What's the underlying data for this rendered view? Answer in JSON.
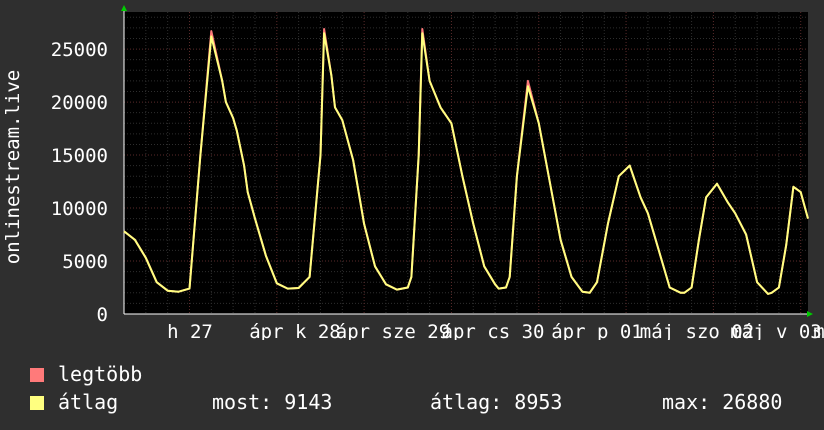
{
  "chart_data": {
    "type": "line",
    "ylabel": "onlinestream.live",
    "ylim": [
      0,
      28500
    ],
    "yticks": [
      0,
      5000,
      10000,
      15000,
      20000,
      25000
    ],
    "x_tick_labels": [
      "h 27",
      "ápr k 28",
      "ápr sze 29",
      "ápr cs 30",
      "ápr p 01",
      "máj szo 02",
      "máj v 03",
      "m"
    ],
    "grid": true,
    "series": [
      {
        "name": "legtöbb",
        "color": "#ff7a7a"
      },
      {
        "name": "átlag",
        "color": "#ffff80"
      }
    ],
    "x_hours": [
      0,
      3,
      6,
      9,
      12,
      15,
      18,
      21,
      24,
      27,
      28,
      30,
      31,
      33,
      34,
      36,
      39,
      42,
      45,
      48,
      51,
      54,
      55,
      57,
      58,
      60,
      63,
      66,
      69,
      72,
      75,
      78,
      79,
      81,
      82,
      84,
      87,
      90,
      93,
      96,
      99,
      102,
      103,
      105,
      106,
      108,
      111,
      114,
      117,
      120,
      123,
      126,
      128,
      130,
      133,
      136,
      139,
      142,
      144,
      147,
      150,
      153,
      154,
      156,
      158,
      160,
      163,
      166,
      168,
      171,
      174,
      177,
      178,
      180,
      182,
      184,
      186,
      188
    ],
    "values": [
      7800,
      7000,
      5300,
      3000,
      2200,
      2100,
      2400,
      15000,
      26200,
      22000,
      20000,
      18500,
      17300,
      14000,
      11500,
      9000,
      5500,
      2900,
      2400,
      2450,
      3500,
      15000,
      26500,
      22500,
      19500,
      18300,
      14500,
      8500,
      4500,
      2800,
      2300,
      2500,
      3500,
      15000,
      26500,
      22000,
      19500,
      18000,
      13000,
      8500,
      4500,
      2800,
      2400,
      2500,
      3500,
      13000,
      21500,
      18000,
      12500,
      7000,
      3500,
      2100,
      2000,
      3000,
      8500,
      13000,
      14000,
      11000,
      9500,
      6000,
      2500,
      2000,
      2000,
      2500,
      7000,
      11000,
      12300,
      10500,
      9500,
      7500,
      3000,
      1900,
      2000,
      2500,
      6500,
      12000,
      11500,
      9000
    ],
    "max_series_peak_excess": [
      0,
      0,
      0,
      0,
      0,
      0,
      0,
      0,
      500,
      0,
      0,
      0,
      0,
      0,
      0,
      0,
      0,
      0,
      0,
      0,
      0,
      0,
      400,
      0,
      0,
      0,
      0,
      0,
      0,
      0,
      0,
      0,
      0,
      0,
      400,
      0,
      0,
      0,
      0,
      0,
      0,
      0,
      0,
      0,
      0,
      0,
      500,
      0,
      0,
      0,
      0,
      0,
      0,
      0,
      0,
      0,
      0,
      0,
      0,
      0,
      0,
      0,
      0,
      0,
      0,
      0,
      0,
      0,
      0,
      0,
      0,
      0,
      0,
      0,
      0,
      0,
      0,
      0
    ]
  },
  "legend": {
    "max_label": "legtöbb",
    "avg_label": "átlag"
  },
  "stats": {
    "now": "most: 9143",
    "avg": "átlag: 8953",
    "max": "max: 26880"
  }
}
